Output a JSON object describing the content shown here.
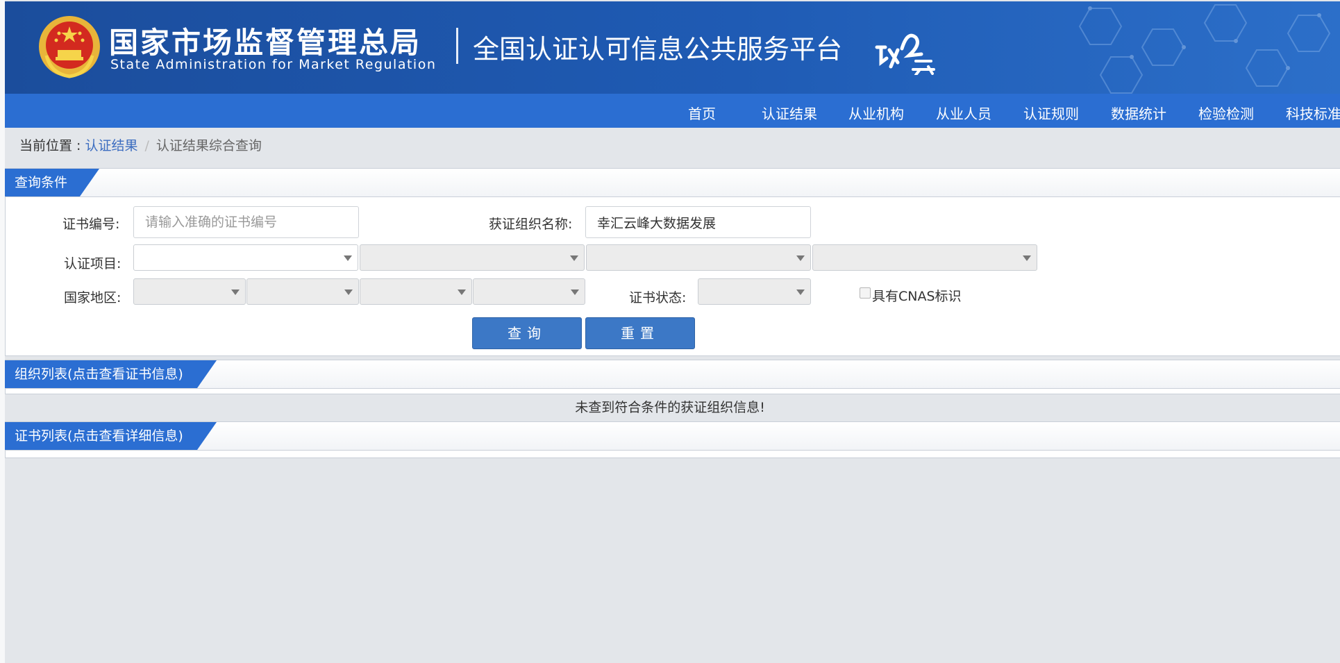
{
  "header": {
    "agency_cn": "国家市场监督管理总局",
    "agency_en": "State Administration  for  Market Regulation",
    "platform_title": "全国认证认可信息公共服务平台",
    "brand_mark": "认证云"
  },
  "nav": {
    "items": [
      {
        "label": "首页"
      },
      {
        "label": "认证结果"
      },
      {
        "label": "从业机构"
      },
      {
        "label": "从业人员"
      },
      {
        "label": "认证规则"
      },
      {
        "label": "数据统计"
      },
      {
        "label": "检验检测"
      },
      {
        "label": "科技标准"
      }
    ]
  },
  "breadcrumb": {
    "prefix": "当前位置 : ",
    "link": "认证结果",
    "separator": "/",
    "current": "认证结果综合查询"
  },
  "query": {
    "section_title": "查询条件",
    "cert_no_label": "证书编号:",
    "cert_no_placeholder": "请输入准确的证书编号",
    "org_name_label": "获证组织名称:",
    "org_name_value": "幸汇云峰大数据发展",
    "cert_item_label": "认证项目:",
    "region_label": "国家地区:",
    "cert_status_label": "证书状态:",
    "cnas_label": "具有CNAS标识",
    "search_button": "查询",
    "reset_button": "重置"
  },
  "org_list": {
    "section_title": "组织列表(点击查看证书信息)",
    "empty_message": "未查到符合条件的获证组织信息!"
  },
  "cert_list": {
    "section_title": "证书列表(点击查看详细信息)"
  },
  "colors": {
    "header_blue": "#1f5bb4",
    "nav_blue": "#2b6ed2",
    "button_blue": "#3c78c6",
    "link_blue": "#3c6dc0"
  }
}
